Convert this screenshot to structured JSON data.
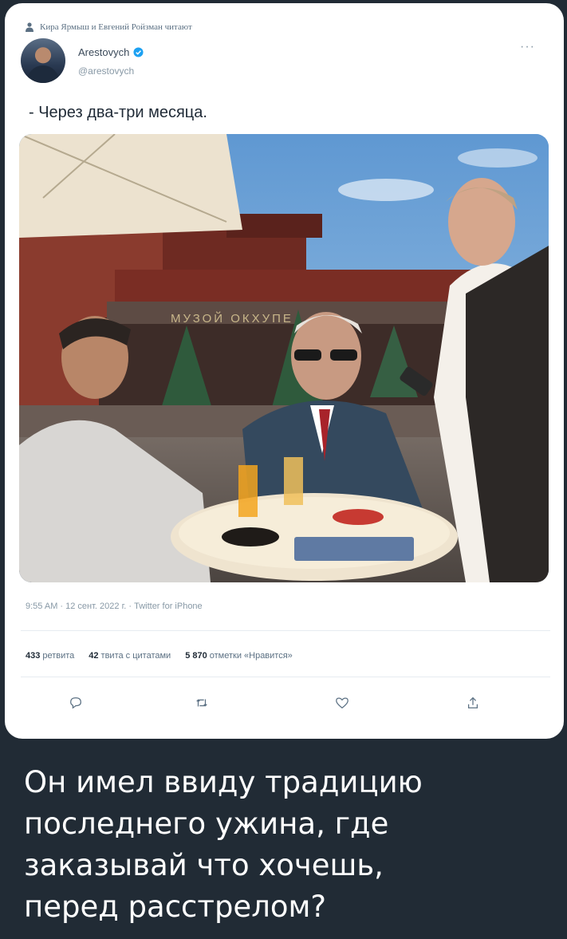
{
  "post": {
    "social_context": "Кира Ярмыш и Евгений Ройзман читают",
    "author_name": "Arestovych",
    "author_handle": "@arestovych",
    "text": "- Через два-три месяца.",
    "timestamp": "9:55 AM · 12 сент. 2022 г. · Twitter for iPhone",
    "stats": {
      "retweets_count": "433",
      "retweets_label": "ретвита",
      "quotes_count": "42",
      "quotes_label": "твита с цитатами",
      "likes_count": "5 870",
      "likes_label": "отметки «Нравится»"
    },
    "actions": [
      "reply-icon",
      "retweet-icon",
      "like-icon",
      "share-icon"
    ],
    "accent_color": "#1da1f2"
  },
  "photo": {
    "sign_text": "МУЗОЙ ОКХУПЕ"
  },
  "caption": "Он имел ввиду традицию\nпоследнего ужина, где\nзаказывай что хочешь,\nперед расстрелом?"
}
